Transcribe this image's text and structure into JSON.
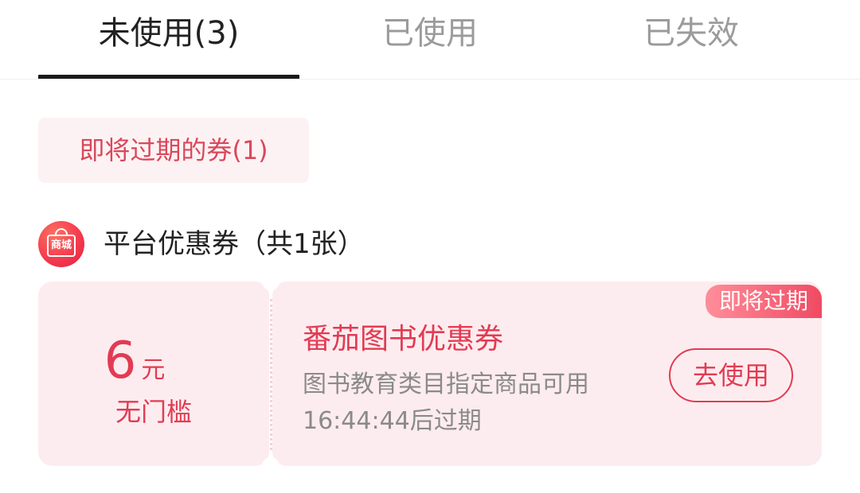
{
  "tabs": [
    {
      "label": "未使用(3)",
      "active": true
    },
    {
      "label": "已使用",
      "active": false
    },
    {
      "label": "已失效",
      "active": false
    }
  ],
  "filter_chip": {
    "label": "即将过期的券(1)"
  },
  "section": {
    "icon_label": "商城",
    "title": "平台优惠券（共1张）"
  },
  "coupon": {
    "amount": "6",
    "unit": "元",
    "condition": "无门槛",
    "name": "番茄图书优惠券",
    "scope": "图书教育类目指定商品可用",
    "expiry": "16:44:44后过期",
    "tag": "即将过期",
    "action_label": "去使用"
  },
  "colors": {
    "accent": "#e23b53",
    "card_bg": "#fdecef",
    "chip_bg": "#fdf2f3",
    "tab_active": "#222222",
    "tab_inactive": "#9b9b9b"
  }
}
